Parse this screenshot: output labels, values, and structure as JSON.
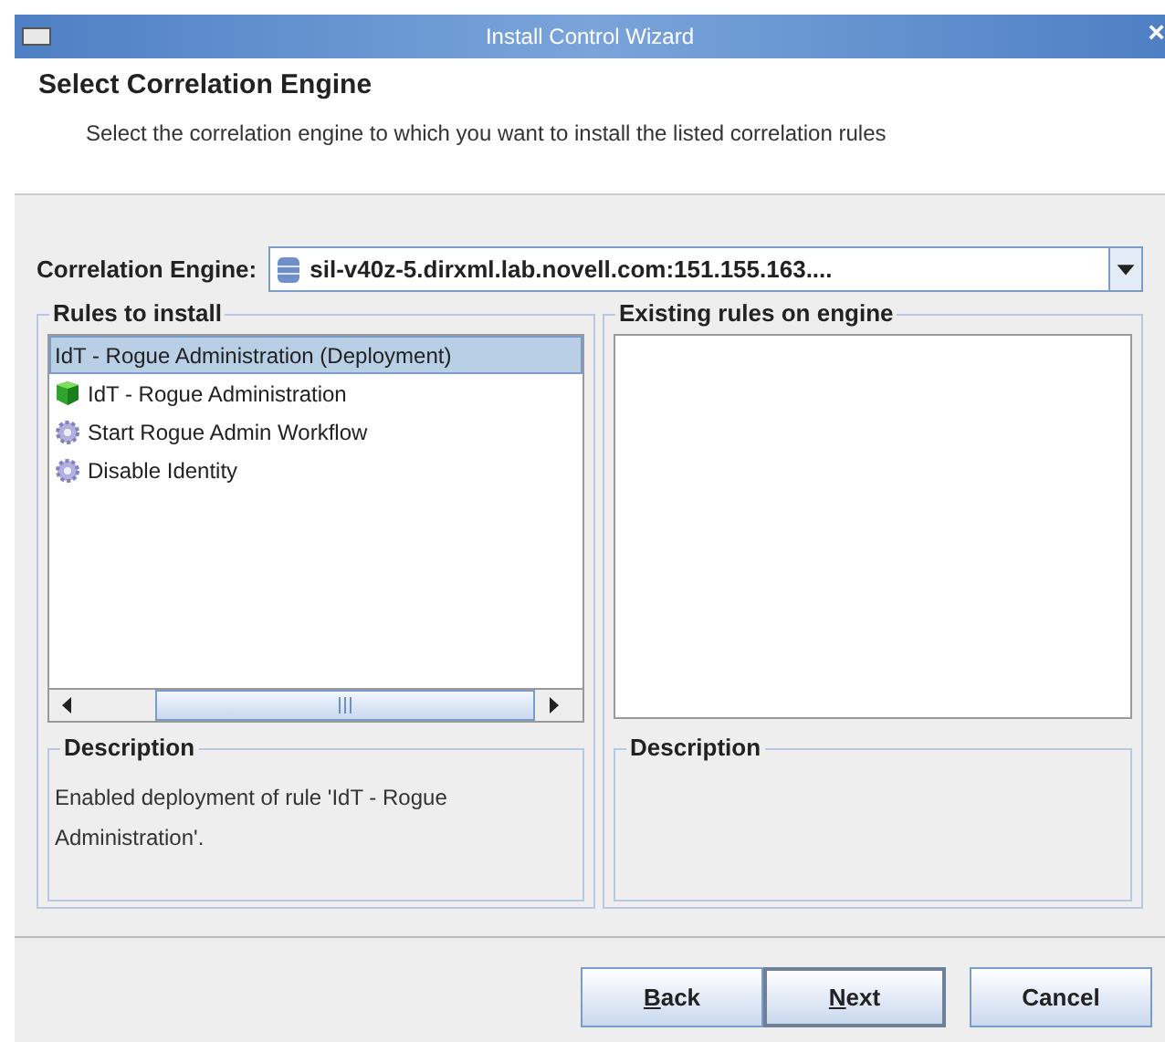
{
  "window": {
    "title": "Install Control Wizard",
    "close": "×"
  },
  "header": {
    "title": "Select Correlation Engine",
    "subtitle": "Select the correlation engine to which you want to install the listed correlation rules"
  },
  "engine": {
    "label": "Correlation Engine:",
    "value": "sil-v40z-5.dirxml.lab.novell.com:151.155.163...."
  },
  "rules": {
    "title": "Rules to install",
    "items": [
      {
        "label": "IdT - Rogue Administration (Deployment)",
        "kind": "plain",
        "selected": true
      },
      {
        "label": "IdT - Rogue Administration",
        "kind": "cube",
        "selected": false
      },
      {
        "label": "Start Rogue Admin Workflow",
        "kind": "gear",
        "selected": false
      },
      {
        "label": "Disable Identity",
        "kind": "gear",
        "selected": false
      }
    ],
    "description_title": "Description",
    "description": "Enabled deployment of rule 'IdT - Rogue Administration'."
  },
  "existing": {
    "title": "Existing rules on engine",
    "description_title": "Description"
  },
  "buttons": [
    {
      "label": "Back",
      "underline_first": true,
      "default": false
    },
    {
      "label": "Next",
      "underline_first": true,
      "default": true
    },
    {
      "label": "Cancel",
      "underline_first": false,
      "default": false
    }
  ]
}
